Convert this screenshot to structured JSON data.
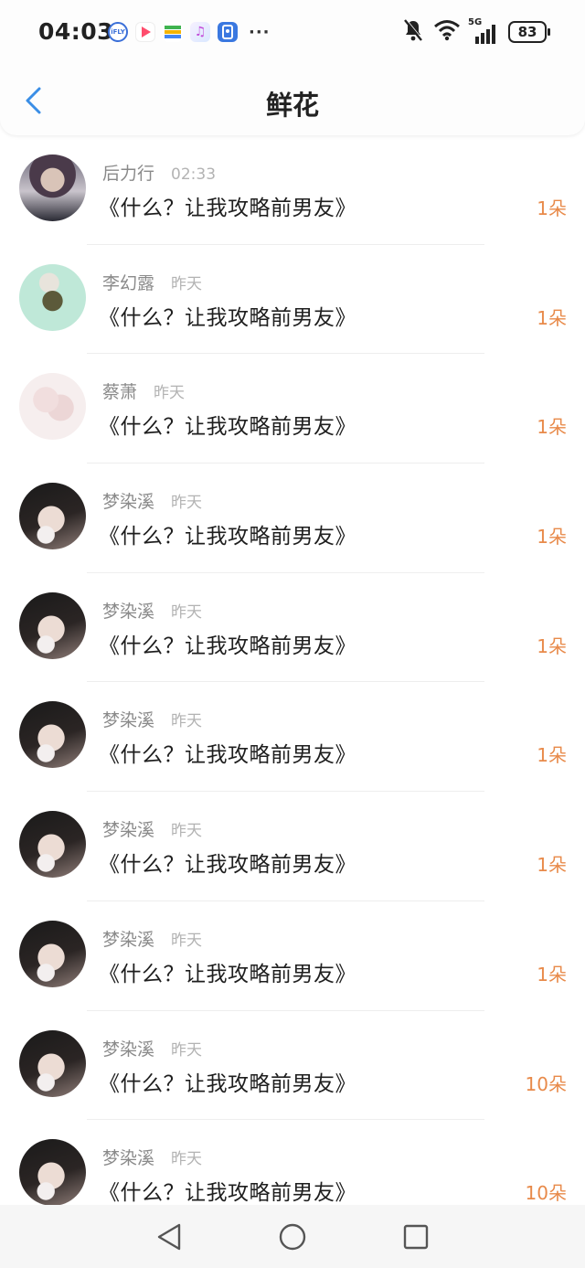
{
  "status_bar": {
    "time": "04:03",
    "app_icons": [
      "iflytek-icon",
      "video-icon",
      "wallet-icon",
      "music-icon",
      "security-icon"
    ],
    "more": "···",
    "network": "5G",
    "battery": "83"
  },
  "header": {
    "title": "鲜花"
  },
  "colors": {
    "accent": "#3a8ee6",
    "count": "#e88a4a",
    "name": "#8a8a8a",
    "time": "#b3b3b3"
  },
  "rows": [
    {
      "name": "后力行",
      "time": "02:33",
      "title": "《什么？让我攻略前男友》",
      "count": "1朵",
      "avatar": "boy"
    },
    {
      "name": "李幻露",
      "time": "昨天",
      "title": "《什么？让我攻略前男友》",
      "count": "1朵",
      "avatar": "anime"
    },
    {
      "name": "蔡萧",
      "time": "昨天",
      "title": "《什么？让我攻略前男友》",
      "count": "1朵",
      "avatar": "balloon"
    },
    {
      "name": "梦染溪",
      "time": "昨天",
      "title": "《什么？让我攻略前男友》",
      "count": "1朵",
      "avatar": "girl"
    },
    {
      "name": "梦染溪",
      "time": "昨天",
      "title": "《什么？让我攻略前男友》",
      "count": "1朵",
      "avatar": "girl"
    },
    {
      "name": "梦染溪",
      "time": "昨天",
      "title": "《什么？让我攻略前男友》",
      "count": "1朵",
      "avatar": "girl"
    },
    {
      "name": "梦染溪",
      "time": "昨天",
      "title": "《什么？让我攻略前男友》",
      "count": "1朵",
      "avatar": "girl"
    },
    {
      "name": "梦染溪",
      "time": "昨天",
      "title": "《什么？让我攻略前男友》",
      "count": "1朵",
      "avatar": "girl"
    },
    {
      "name": "梦染溪",
      "time": "昨天",
      "title": "《什么？让我攻略前男友》",
      "count": "10朵",
      "avatar": "girl"
    },
    {
      "name": "梦染溪",
      "time": "昨天",
      "title": "《什么？让我攻略前男友》",
      "count": "10朵",
      "avatar": "girl"
    }
  ],
  "bottom_nav": [
    "back-triangle-icon",
    "home-circle-icon",
    "recents-square-icon"
  ]
}
